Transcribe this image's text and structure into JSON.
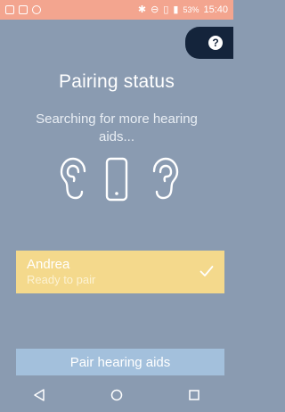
{
  "status_bar": {
    "battery": "53%",
    "time": "15:40",
    "icons": [
      "image-icon",
      "image-icon",
      "location-icon",
      "bluetooth-icon",
      "do-not-disturb-icon",
      "vibrate-icon",
      "battery-icon"
    ]
  },
  "help": {
    "label": "?"
  },
  "page": {
    "title": "Pairing status",
    "subtitle": "Searching for more hearing aids..."
  },
  "illustration": {
    "icons": [
      "left-ear-icon",
      "phone-icon",
      "right-ear-icon"
    ]
  },
  "device": {
    "name": "Andrea",
    "status": "Ready to pair",
    "selected": true
  },
  "actions": {
    "pair_label": "Pair hearing aids"
  },
  "nav": {
    "buttons": [
      "back-icon",
      "home-icon",
      "recents-icon"
    ]
  },
  "colors": {
    "background": "#8a9bb1",
    "status_bar": "#f3a58f",
    "help_tab": "#14243b",
    "device_card": "#f4d98c",
    "pair_button": "#a3c0dc"
  }
}
